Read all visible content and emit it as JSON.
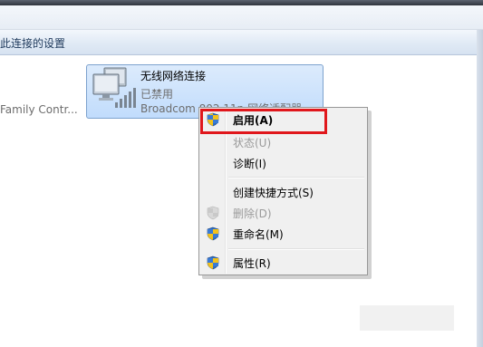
{
  "command_bar": {
    "label": "此连接的设置"
  },
  "connections": {
    "left_partial": {
      "label": "Family Contr..."
    },
    "selected": {
      "name": "无线网络连接",
      "status": "已禁用",
      "adapter": "Broadcom 802.11n 网络适配器",
      "icon": "wireless-network-icon"
    }
  },
  "context_menu": {
    "items": [
      {
        "label": "启用(A)",
        "bold": true,
        "disabled": false,
        "icon": "uac-shield-icon"
      },
      {
        "label": "状态(U)",
        "bold": false,
        "disabled": true,
        "icon": ""
      },
      {
        "label": "诊断(I)",
        "bold": false,
        "disabled": false,
        "icon": ""
      },
      {
        "label": "创建快捷方式(S)",
        "bold": false,
        "disabled": false,
        "icon": ""
      },
      {
        "label": "删除(D)",
        "bold": false,
        "disabled": true,
        "icon": "uac-shield-disabled-icon"
      },
      {
        "label": "重命名(M)",
        "bold": false,
        "disabled": false,
        "icon": "uac-shield-icon"
      },
      {
        "label": "属性(R)",
        "bold": false,
        "disabled": false,
        "icon": "uac-shield-icon"
      }
    ]
  },
  "colors": {
    "highlight_border": "#e0171c",
    "tile_background": "#c1dcfc",
    "menu_background": "#f0f0f0",
    "disabled_text": "#9a9a9a"
  }
}
